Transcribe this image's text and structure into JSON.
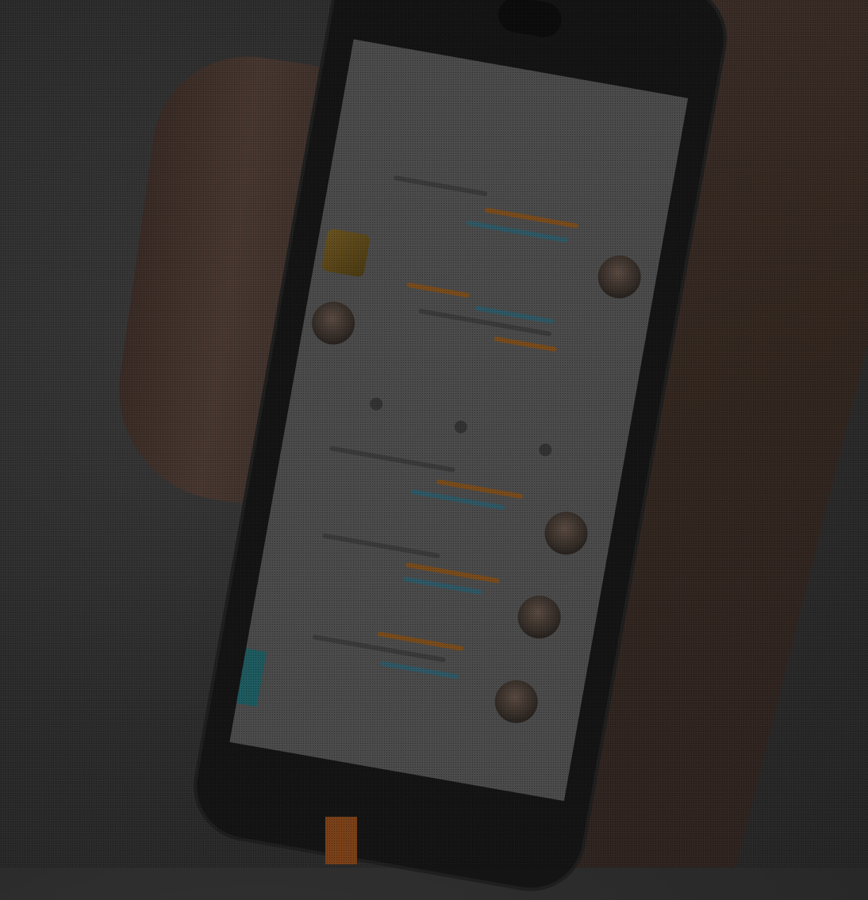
{
  "scene": {
    "description_tags": [
      "hand-holding-phone",
      "social-feed-app"
    ],
    "colors": {
      "accent_orange": "#e8852a",
      "accent_cyan": "#2ab7c4",
      "screen_bg": "#f2f2f2",
      "phone_body": "#141414"
    }
  },
  "app": {
    "status_text": "",
    "tab_label": "",
    "feed_items": [
      {
        "avatar_style": "round"
      },
      {
        "avatar_style": "square-yellow"
      },
      {
        "avatar_style": "round"
      },
      {
        "avatar_style": "round"
      },
      {
        "avatar_style": "round"
      },
      {
        "avatar_style": "round"
      }
    ]
  }
}
